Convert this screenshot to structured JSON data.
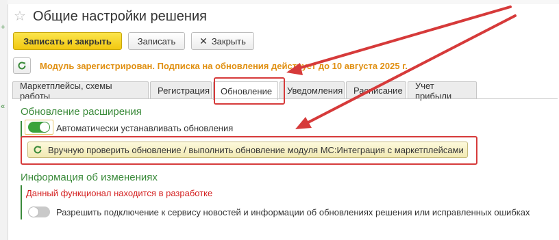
{
  "window": {
    "title": "Общие настройки решения"
  },
  "toolbar": {
    "save_close_label": "Записать и закрыть",
    "save_label": "Записать",
    "close_label": "Закрыть"
  },
  "notice": {
    "text": "Модуль зарегистрирован. Подписка на обновления действует до 10 августа 2025 г."
  },
  "tabs": [
    {
      "label": "Маркетплейсы, схемы работы"
    },
    {
      "label": "Регистрация"
    },
    {
      "label": "Обновление",
      "active": true
    },
    {
      "label": "Уведомления"
    },
    {
      "label": "Расписание"
    },
    {
      "label": "Учет прибыли"
    }
  ],
  "update_section": {
    "title": "Обновление расширения",
    "auto_update": {
      "label": "Автоматически устанавливать обновления",
      "enabled": true
    },
    "check_button_label": "Вручную проверить обновление / выполнить обновление модуля МС:Интеграция с маркетплейсами"
  },
  "info_section": {
    "title": "Информация об изменениях",
    "dev_note": "Данный функционал находится в разработке",
    "news": {
      "label": "Разрешить подключение к сервису новостей и информации об обновлениях решения или исправленных ошибках",
      "enabled": false
    }
  },
  "colors": {
    "accent_green": "#3a8a3a",
    "primary_yellow": "#f2c811",
    "notice_orange": "#e08f10",
    "annotation_red": "#d63a3a"
  }
}
